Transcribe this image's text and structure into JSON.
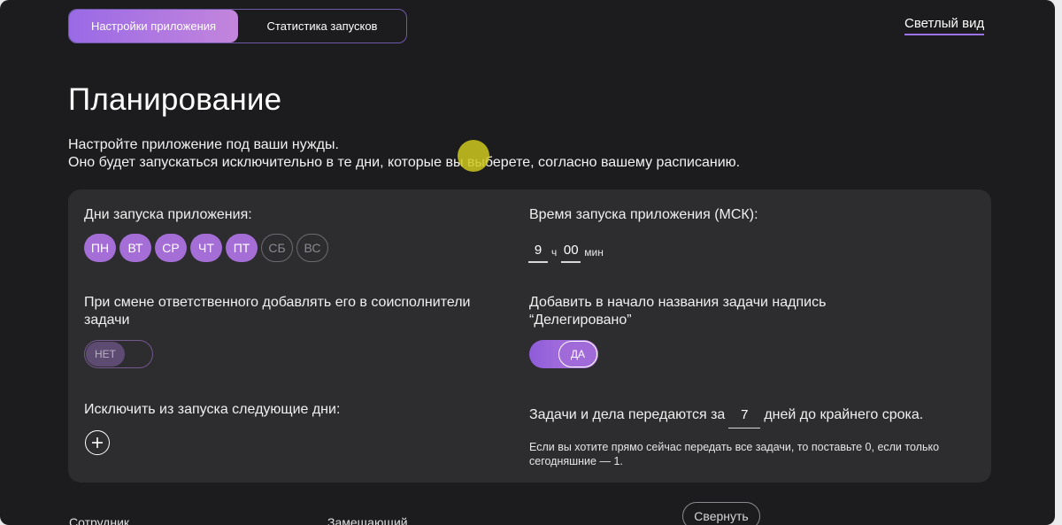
{
  "tabs": [
    {
      "label": "Настройки приложения",
      "active": true
    },
    {
      "label": "Статистика запусков",
      "active": false
    }
  ],
  "theme_link": "Светлый вид",
  "page": {
    "title": "Планирование",
    "intro_line1": "Настройте приложение под ваши нужды.",
    "intro_line2": "Оно будет запускаться исключительно в те дни, которые вы выберете, согласно вашему расписанию."
  },
  "schedule": {
    "days_label": "Дни запуска приложения:",
    "days": [
      {
        "label": "ПН",
        "selected": true
      },
      {
        "label": "ВТ",
        "selected": true
      },
      {
        "label": "СР",
        "selected": true
      },
      {
        "label": "ЧТ",
        "selected": true
      },
      {
        "label": "ПТ",
        "selected": true
      },
      {
        "label": "СБ",
        "selected": false
      },
      {
        "label": "ВС",
        "selected": false
      }
    ],
    "time_label": "Время запуска приложения (МСК):",
    "hours": "9",
    "hours_unit": "ч",
    "minutes": "00",
    "minutes_unit": "мин"
  },
  "coexecutor": {
    "label": "При смене ответственного добавлять его в соисполнители задачи",
    "toggle_label": "НЕТ",
    "enabled": false
  },
  "delegated": {
    "label_line1": "Добавить в начало названия задачи надпись",
    "label_line2": "“Делегировано”",
    "toggle_label": "ДА",
    "enabled": true
  },
  "exclude": {
    "label": "Исключить из запуска следующие дни:",
    "add_icon": "plus-circle-icon"
  },
  "deadline": {
    "prefix": "Задачи и дела передаются за",
    "days_value": "7",
    "suffix": "дней до крайнего срока.",
    "note": "Если вы хотите прямо сейчас передать все задачи, то поставьте 0, если только сегодняшние — 1."
  },
  "footer": {
    "col_employee": "Сотрудник",
    "col_substitute": "Замещающий",
    "collapse_label": "Свернуть"
  }
}
